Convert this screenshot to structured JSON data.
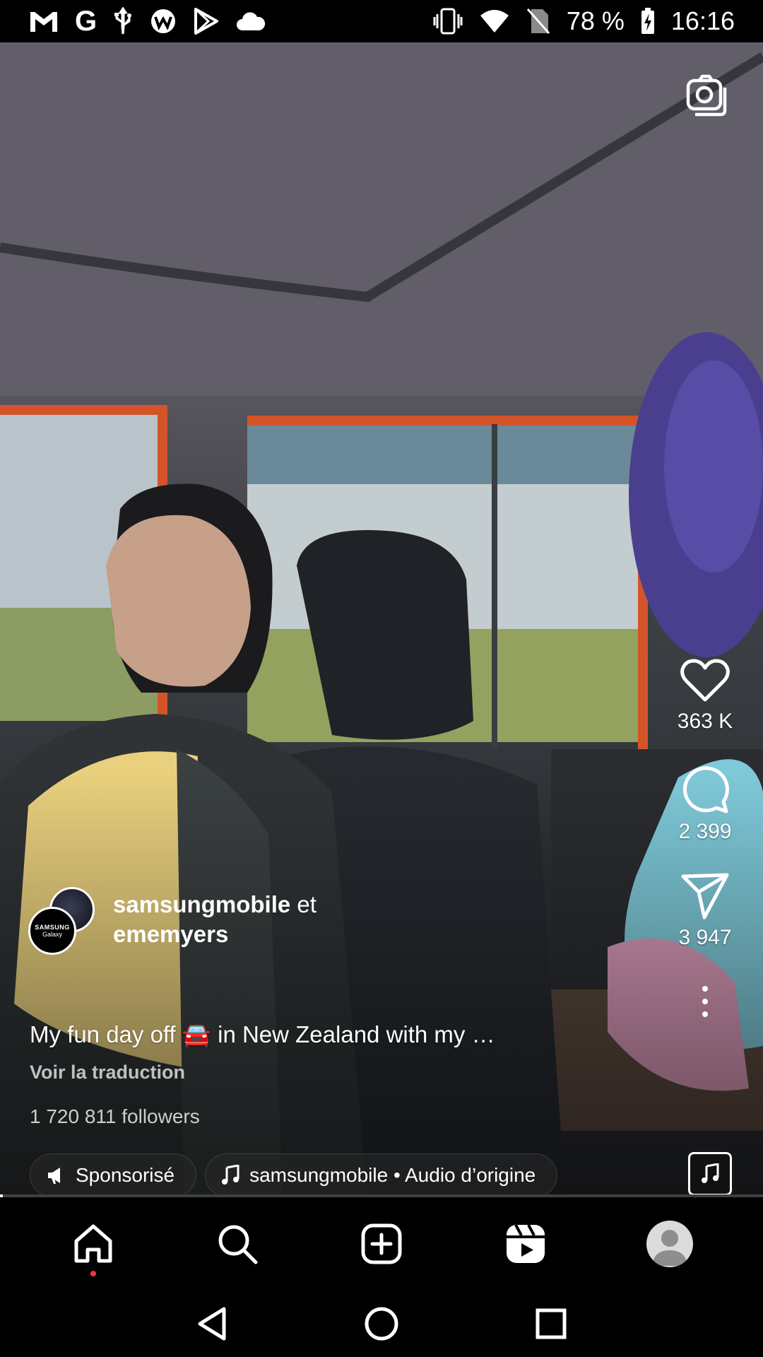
{
  "status_bar": {
    "left_icons": [
      "gmail-icon",
      "google-icon",
      "usb-icon",
      "vpn-icon",
      "play-store-icon",
      "cloud-icon"
    ],
    "right_icons": [
      "vibrate-icon",
      "wifi-icon",
      "no-sim-icon",
      "battery-charging-icon"
    ],
    "battery": "78 %",
    "time": "16:16"
  },
  "reel": {
    "author_primary": "samsungmobile",
    "author_joiner": "et",
    "author_secondary": "ememyers",
    "avatar_brand": "SAMSUNG",
    "avatar_sub": "Galaxy",
    "caption_start": "My fun day off",
    "caption_emoji": "🚘",
    "caption_end": "in New Zealand with my …",
    "translate_link": "Voir la traduction",
    "followers": "1 720 811 followers",
    "sponsored_chip": "Sponsorisé",
    "audio_chip": "samsungmobile • Audio d’origine",
    "progress": 0.004
  },
  "actions": {
    "likes": "363 K",
    "comments": "2 399",
    "shares": "3 947"
  },
  "bottom_nav": {
    "items": [
      "home-icon",
      "search-icon",
      "create-icon",
      "reels-icon",
      "profile-icon"
    ]
  },
  "system_nav": {
    "items": [
      "back-icon",
      "home-circle-icon",
      "recents-icon"
    ]
  }
}
